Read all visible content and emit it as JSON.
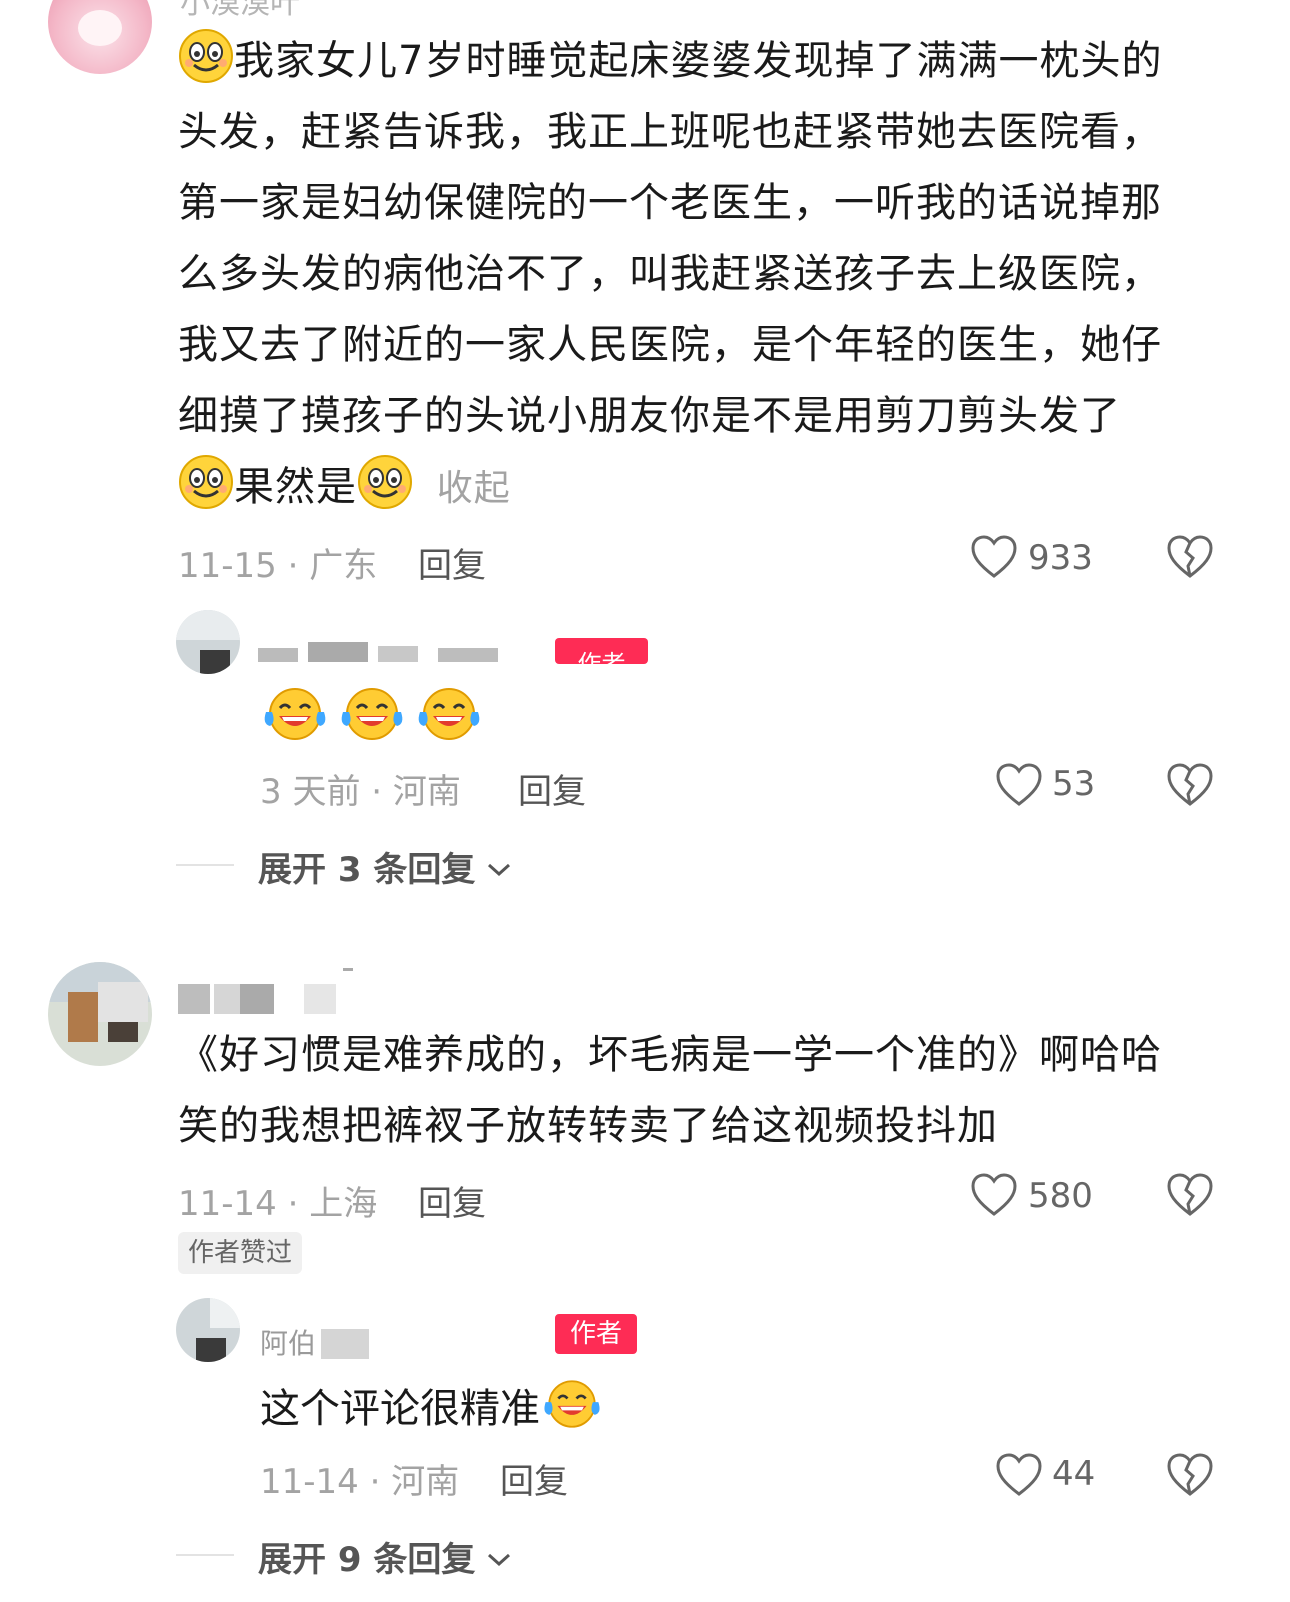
{
  "comment1": {
    "username": "小漠漠叶",
    "text_line1": "我家女儿7岁时睡觉起床婆婆发现掉了满满一枕头的",
    "text_line2": "头发，赶紧告诉我，我正上班呢也赶紧带她去医院看，",
    "text_line3": "第一家是妇幼保健院的一个老医生，一听我的话说掉那",
    "text_line4": "么多头发的病他治不了，叫我赶紧送孩子去上级医院，",
    "text_line5": "我又去了附近的一家人民医院，是个年轻的医生，她仔",
    "text_line6": "细摸了摸孩子的头说小朋友你是不是用剪刀剪头发了",
    "text_line7": "果然是",
    "collapse_label": "收起",
    "date_location": "11-15 · 广东",
    "reply_label": "回复",
    "likes": "933",
    "reply": {
      "badge": "作者",
      "date_location": "3 天前 · 河南",
      "reply_label": "回复",
      "likes": "53"
    },
    "expand_label": "展开 3 条回复"
  },
  "comment2": {
    "text_line1": "《好习惯是难养成的，坏毛病是一学一个准的》啊哈哈",
    "text_line2": "笑的我想把裤衩子放转转卖了给这视频投抖加",
    "date_location": "11-14 · 上海",
    "reply_label": "回复",
    "likes": "580",
    "author_liked": "作者赞过",
    "reply": {
      "username": "阿伯",
      "badge": "作者",
      "text": "这个评论很精准",
      "date_location": "11-14 · 河南",
      "reply_label": "回复",
      "likes": "44"
    },
    "expand_label": "展开 9 条回复"
  },
  "icons": {
    "like": "heart-outline-icon",
    "dislike": "broken-heart-icon",
    "chevron": "chevron-down-icon",
    "emoji_smile": "smile-emoji-icon",
    "emoji_cry_laugh": "tears-of-joy-emoji-icon"
  },
  "colors": {
    "badge": "#fe2c55",
    "meta": "#a3a3a3",
    "text": "#1a1a1a"
  }
}
